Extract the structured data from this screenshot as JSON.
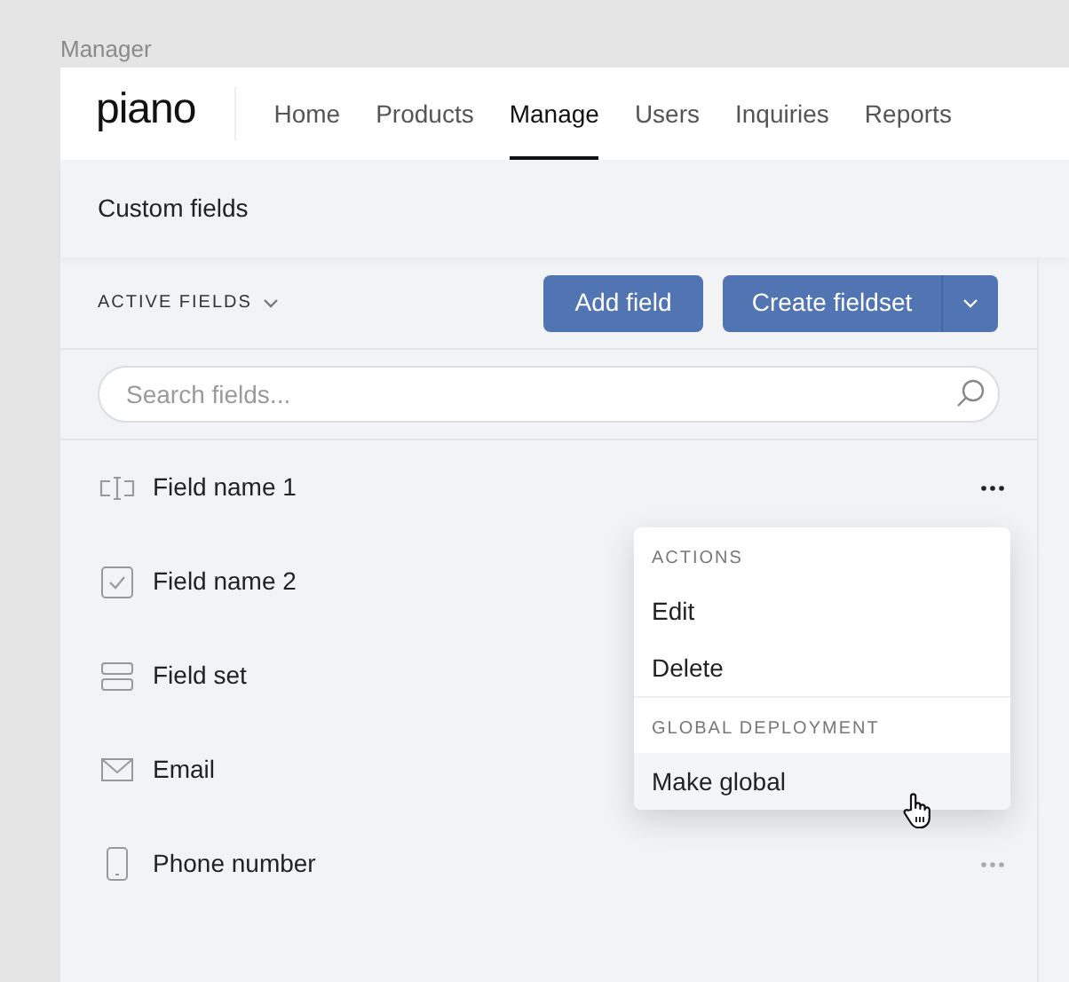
{
  "window": {
    "title": "Manager"
  },
  "nav": {
    "logo": "piano",
    "items": [
      {
        "label": "Home",
        "selected": false
      },
      {
        "label": "Products",
        "selected": false
      },
      {
        "label": "Manage",
        "selected": true
      },
      {
        "label": "Users",
        "selected": false
      },
      {
        "label": "Inquiries",
        "selected": false
      },
      {
        "label": "Reports",
        "selected": false
      }
    ]
  },
  "page_title": "Custom fields",
  "toolbar": {
    "filter": "ACTIVE FIELDS",
    "add_button": "Add field",
    "create_button": "Create fieldset"
  },
  "search": {
    "placeholder": "Search fields..."
  },
  "fields": [
    {
      "kind": "text",
      "label": "Field name 1",
      "menu_open": true
    },
    {
      "kind": "checkbox",
      "label": "Field name 2"
    },
    {
      "kind": "fieldset",
      "label": "Field set"
    },
    {
      "kind": "email",
      "label": "Email"
    },
    {
      "kind": "phone",
      "label": "Phone number",
      "menu_open": false
    }
  ],
  "menu": {
    "sections": [
      {
        "heading": "ACTIONS",
        "items": [
          {
            "label": "Edit",
            "hovered": false
          },
          {
            "label": "Delete",
            "hovered": false
          }
        ]
      },
      {
        "heading": "GLOBAL DEPLOYMENT",
        "items": [
          {
            "label": "Make global",
            "hovered": true
          }
        ]
      }
    ]
  }
}
